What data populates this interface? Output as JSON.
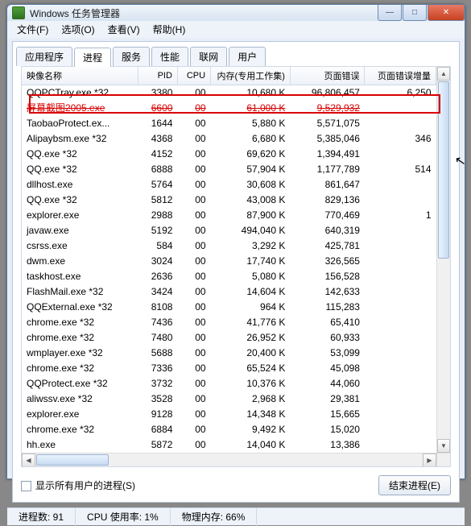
{
  "title": "Windows 任务管理器",
  "menus": [
    "文件(F)",
    "选项(O)",
    "查看(V)",
    "帮助(H)"
  ],
  "tabs": [
    "应用程序",
    "进程",
    "服务",
    "性能",
    "联网",
    "用户"
  ],
  "active_tab": 1,
  "columns": [
    {
      "label": "映像名称",
      "align": "l",
      "w": "140"
    },
    {
      "label": "PID",
      "align": "r",
      "w": "48"
    },
    {
      "label": "CPU",
      "align": "r",
      "w": "40"
    },
    {
      "label": "内存(专用工作集)",
      "align": "r",
      "w": "96"
    },
    {
      "label": "页面错误",
      "align": "r",
      "w": "90"
    },
    {
      "label": "页面错误增量",
      "align": "r",
      "w": "86"
    }
  ],
  "rows": [
    {
      "name": "QQPCTray.exe *32",
      "pid": "3380",
      "cpu": "00",
      "mem": "10,680 K",
      "pf": "96,806,457",
      "pfd": "6,250",
      "hl": 1
    },
    {
      "name": "屏幕截图2005.exe",
      "pid": "6600",
      "cpu": "00",
      "mem": "61,000 K",
      "pf": "9,529,932",
      "pfd": "",
      "strike": 1
    },
    {
      "name": "TaobaoProtect.ex...",
      "pid": "1644",
      "cpu": "00",
      "mem": "5,880 K",
      "pf": "5,571,075",
      "pfd": ""
    },
    {
      "name": "Alipaybsm.exe *32",
      "pid": "4368",
      "cpu": "00",
      "mem": "6,680 K",
      "pf": "5,385,046",
      "pfd": "346"
    },
    {
      "name": "QQ.exe *32",
      "pid": "4152",
      "cpu": "00",
      "mem": "69,620 K",
      "pf": "1,394,491",
      "pfd": ""
    },
    {
      "name": "QQ.exe *32",
      "pid": "6888",
      "cpu": "00",
      "mem": "57,904 K",
      "pf": "1,177,789",
      "pfd": "514"
    },
    {
      "name": "dllhost.exe",
      "pid": "5764",
      "cpu": "00",
      "mem": "30,608 K",
      "pf": "861,647",
      "pfd": ""
    },
    {
      "name": "QQ.exe *32",
      "pid": "5812",
      "cpu": "00",
      "mem": "43,008 K",
      "pf": "829,136",
      "pfd": ""
    },
    {
      "name": "explorer.exe",
      "pid": "2988",
      "cpu": "00",
      "mem": "87,900 K",
      "pf": "770,469",
      "pfd": "1"
    },
    {
      "name": "javaw.exe",
      "pid": "5192",
      "cpu": "00",
      "mem": "494,040 K",
      "pf": "640,319",
      "pfd": ""
    },
    {
      "name": "csrss.exe",
      "pid": "584",
      "cpu": "00",
      "mem": "3,292 K",
      "pf": "425,781",
      "pfd": ""
    },
    {
      "name": "dwm.exe",
      "pid": "3024",
      "cpu": "00",
      "mem": "17,740 K",
      "pf": "326,565",
      "pfd": ""
    },
    {
      "name": "taskhost.exe",
      "pid": "2636",
      "cpu": "00",
      "mem": "5,080 K",
      "pf": "156,528",
      "pfd": ""
    },
    {
      "name": "FlashMail.exe *32",
      "pid": "3424",
      "cpu": "00",
      "mem": "14,604 K",
      "pf": "142,633",
      "pfd": ""
    },
    {
      "name": "QQExternal.exe *32",
      "pid": "8108",
      "cpu": "00",
      "mem": "964 K",
      "pf": "115,283",
      "pfd": ""
    },
    {
      "name": "chrome.exe *32",
      "pid": "7436",
      "cpu": "00",
      "mem": "41,776 K",
      "pf": "65,410",
      "pfd": ""
    },
    {
      "name": "chrome.exe *32",
      "pid": "7480",
      "cpu": "00",
      "mem": "26,952 K",
      "pf": "60,933",
      "pfd": ""
    },
    {
      "name": "wmplayer.exe *32",
      "pid": "5688",
      "cpu": "00",
      "mem": "20,400 K",
      "pf": "53,099",
      "pfd": ""
    },
    {
      "name": "chrome.exe *32",
      "pid": "7336",
      "cpu": "00",
      "mem": "65,524 K",
      "pf": "45,098",
      "pfd": ""
    },
    {
      "name": "QQProtect.exe *32",
      "pid": "3732",
      "cpu": "00",
      "mem": "10,376 K",
      "pf": "44,060",
      "pfd": ""
    },
    {
      "name": "aliwssv.exe *32",
      "pid": "3528",
      "cpu": "00",
      "mem": "2,968 K",
      "pf": "29,381",
      "pfd": ""
    },
    {
      "name": "explorer.exe",
      "pid": "9128",
      "cpu": "00",
      "mem": "14,348 K",
      "pf": "15,665",
      "pfd": ""
    },
    {
      "name": "chrome.exe *32",
      "pid": "6884",
      "cpu": "00",
      "mem": "9,492 K",
      "pf": "15,020",
      "pfd": ""
    },
    {
      "name": "hh.exe",
      "pid": "5872",
      "cpu": "00",
      "mem": "14,040 K",
      "pf": "13,386",
      "pfd": ""
    }
  ],
  "show_all_label": "显示所有用户的进程(S)",
  "end_process": "结束进程(E)",
  "status": {
    "procs": "进程数: 91",
    "cpu": "CPU 使用率: 1%",
    "mem": "物理内存: 66%"
  }
}
